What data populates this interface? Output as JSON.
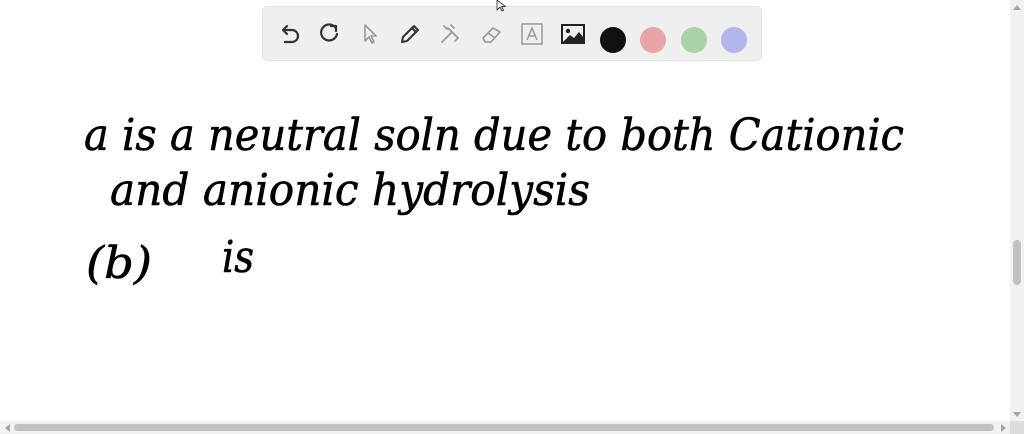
{
  "toolbar": {
    "tools": [
      {
        "name": "undo-icon"
      },
      {
        "name": "redo-icon"
      },
      {
        "name": "select-pointer-icon"
      },
      {
        "name": "pen-icon"
      },
      {
        "name": "tools-icon"
      },
      {
        "name": "eraser-icon"
      },
      {
        "name": "text-icon"
      },
      {
        "name": "image-icon"
      }
    ],
    "colors": [
      "#111111",
      "#e8a4a8",
      "#a9d3a6",
      "#b3b5ea"
    ]
  },
  "handwriting": {
    "line1": "a is a neutral soln due to both Cationic",
    "line2": "and anionic hydrolysis",
    "line3_label": "(b)",
    "line3_text": "is"
  }
}
